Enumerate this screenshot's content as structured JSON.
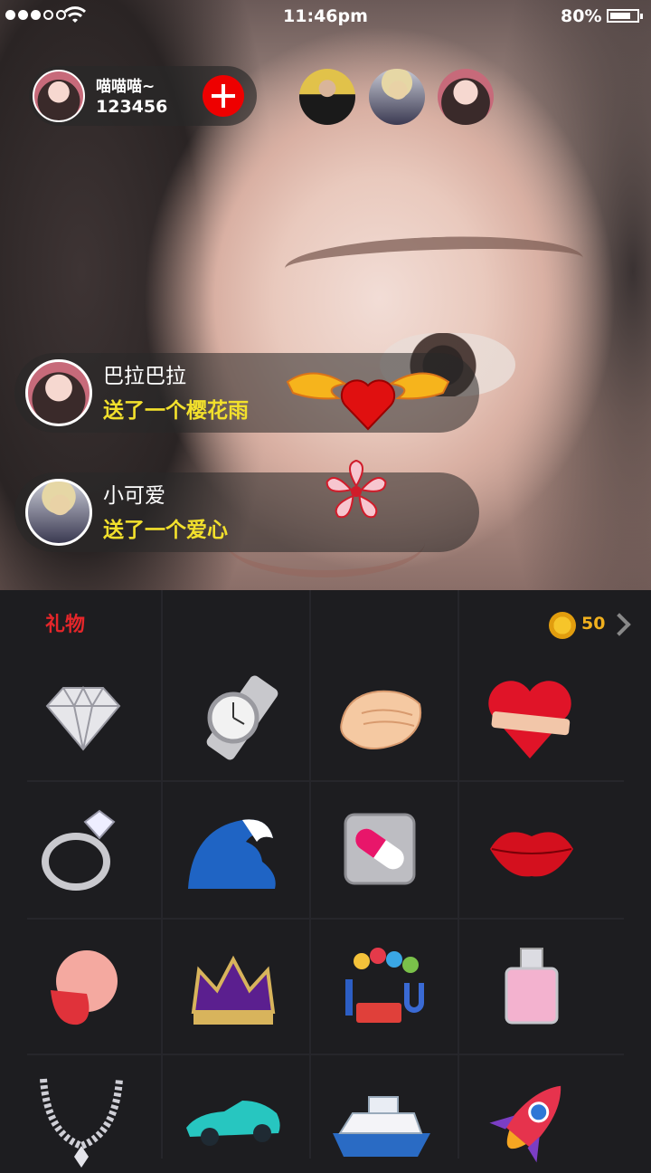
{
  "status_bar": {
    "time": "11:46pm",
    "battery": "80%"
  },
  "host": {
    "name": "喵喵喵~",
    "id": "123456"
  },
  "viewers": [
    "viewer-1",
    "viewer-2",
    "viewer-3"
  ],
  "messages": [
    {
      "name": "巴拉巴拉",
      "text": "送了一个樱花雨"
    },
    {
      "name": "小可爱",
      "text": "送了一个爱心"
    }
  ],
  "gift_panel": {
    "title": "礼物",
    "coins": "50"
  },
  "colors": {
    "accent_red": "#e5262a",
    "message_yellow": "#f2e02c",
    "coin": "#f0b01e"
  },
  "gifts": [
    "diamond-icon",
    "watch-icon",
    "clapping-hands-icon",
    "rose-heart-icon",
    "ring-icon",
    "wave-icon",
    "pill-icon",
    "lips-icon",
    "tongue-face-icon",
    "crown-icon",
    "love-balloons-icon",
    "perfume-icon",
    "necklace-icon",
    "sports-car-icon",
    "cruise-ship-icon",
    "rocket-icon"
  ]
}
